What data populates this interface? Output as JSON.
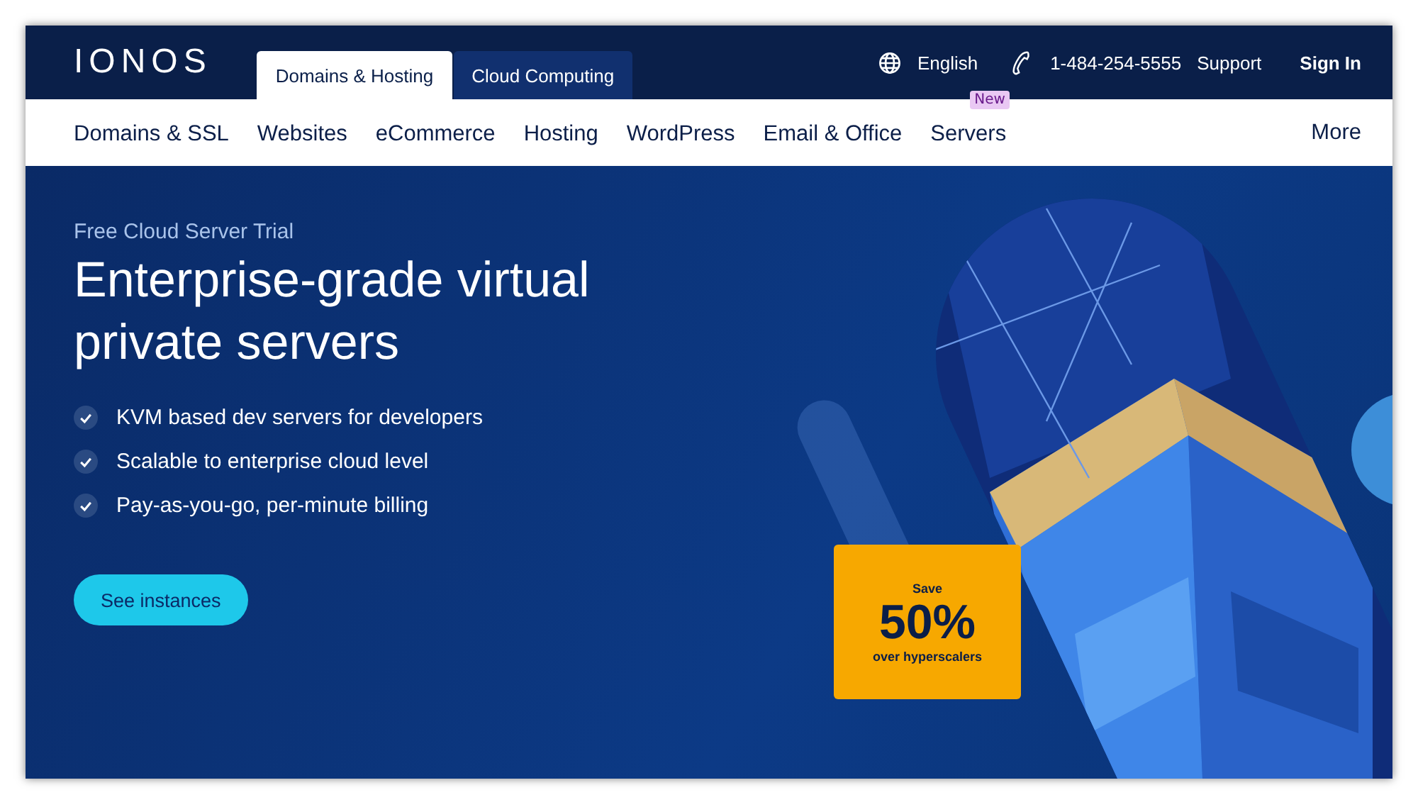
{
  "brand": {
    "logo": "IONOS"
  },
  "top_tabs": [
    {
      "label": "Domains & Hosting",
      "selected": true
    },
    {
      "label": "Cloud Computing",
      "selected": false
    }
  ],
  "utility_links": [
    {
      "kind": "language",
      "label": "English"
    },
    {
      "kind": "phone",
      "label": "1-484-254-5555"
    },
    {
      "kind": "link",
      "label": "Support"
    },
    {
      "kind": "signin",
      "label": "Sign In"
    }
  ],
  "nav": {
    "items": [
      {
        "label": "Domains & SSL"
      },
      {
        "label": "Websites"
      },
      {
        "label": "eCommerce"
      },
      {
        "label": "Hosting"
      },
      {
        "label": "WordPress"
      },
      {
        "label": "Email & Office"
      },
      {
        "label": "Servers",
        "badge": "New"
      }
    ],
    "more": "More"
  },
  "hero": {
    "eyebrow": "Free Cloud Server Trial",
    "title": "Enterprise-grade virtual private servers",
    "features": [
      "KVM based dev servers for developers",
      "Scalable to enterprise cloud level",
      "Pay-as-you-go, per-minute billing"
    ],
    "cta": "See instances",
    "promo": {
      "top": "Save",
      "big": "50%",
      "bottom": "over hyperscalers"
    },
    "image": {
      "kind": "picture"
    }
  }
}
